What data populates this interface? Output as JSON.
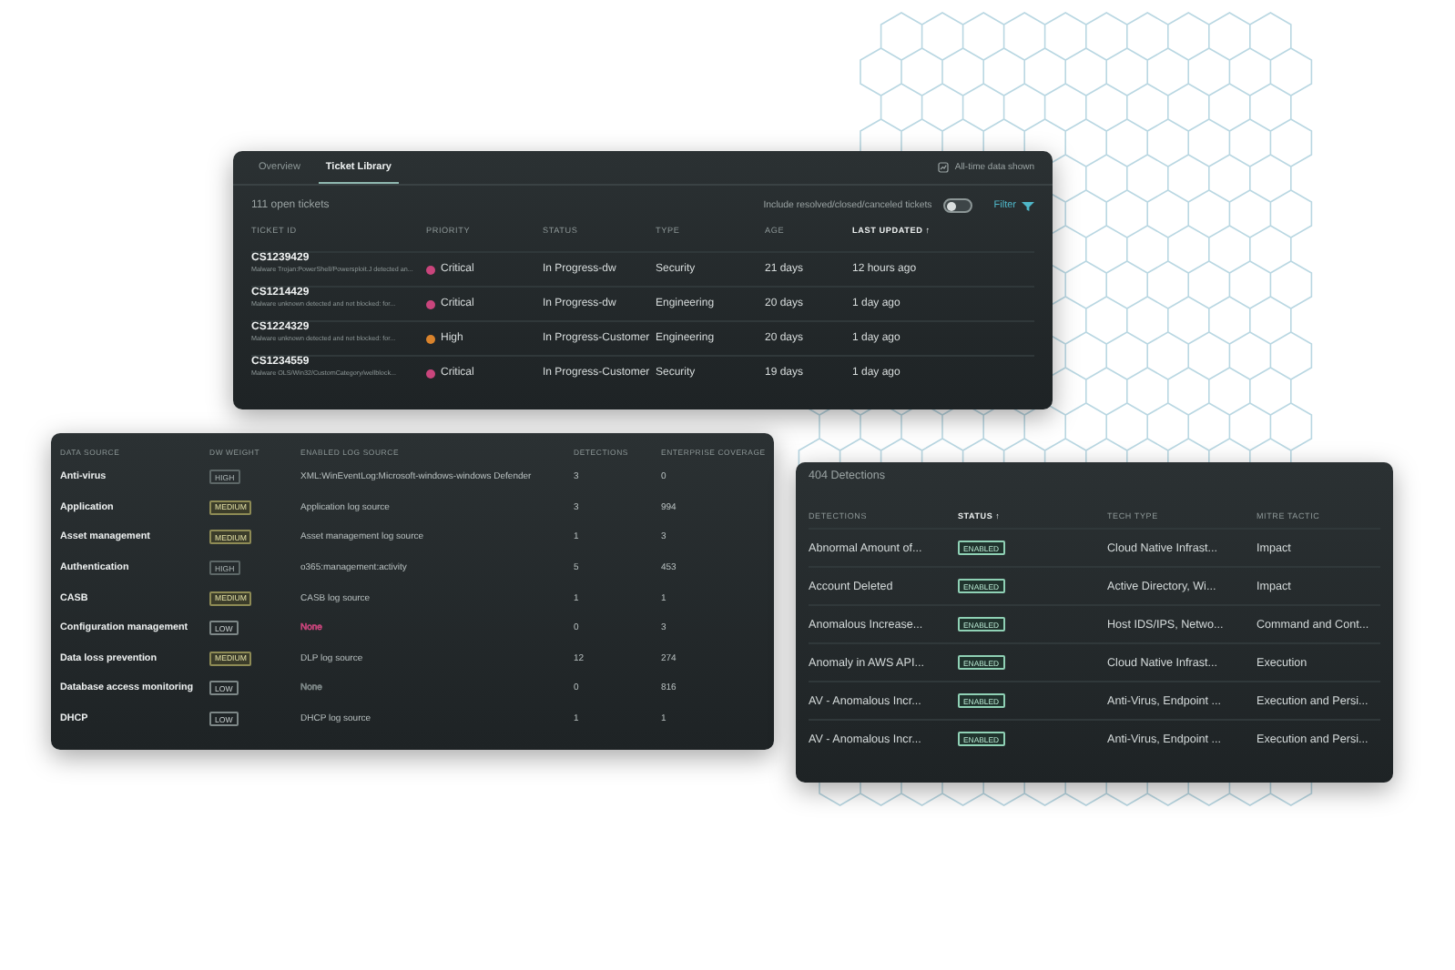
{
  "tickets": {
    "tabs": [
      {
        "label": "Overview",
        "selected": false
      },
      {
        "label": "Ticket Library",
        "selected": true
      }
    ],
    "range_note": "All-time data shown",
    "count": "111 open tickets",
    "include_label": "Include resolved/closed/canceled tickets",
    "include_on": false,
    "filter": "Filter",
    "columns": [
      {
        "label": "TICKET ID",
        "sorted": false
      },
      {
        "label": "PRIORITY",
        "sorted": false
      },
      {
        "label": "STATUS",
        "sorted": false
      },
      {
        "label": "TYPE",
        "sorted": false
      },
      {
        "label": "AGE",
        "sorted": false
      },
      {
        "label": "LAST UPDATED ↑",
        "sorted": true
      }
    ],
    "rows": [
      {
        "id": "CS1239429",
        "summary": "Malware Trojan:PowerShell/Powersploit.J detected an...",
        "priority": "Critical",
        "color": "#c9457c",
        "status": "In Progress-dw",
        "type": "Security",
        "age": "21 days",
        "updated": "12 hours ago"
      },
      {
        "id": "CS1214429",
        "summary": "Malware unknown detected and not blocked: for...",
        "priority": "Critical",
        "color": "#c9457c",
        "status": "In Progress-dw",
        "type": "Engineering",
        "age": "20 days",
        "updated": "1 day ago"
      },
      {
        "id": "CS1224329",
        "summary": "Malware unknown detected and not blocked: for...",
        "priority": "High",
        "color": "#d9832c",
        "status": "In Progress-Customer",
        "type": "Engineering",
        "age": "20 days",
        "updated": "1 day ago"
      },
      {
        "id": "CS1234559",
        "summary": "Malware OLS/Win32/CustomCategory/wellblock...",
        "priority": "Critical",
        "color": "#c9457c",
        "status": "In Progress-Customer",
        "type": "Security",
        "age": "19 days",
        "updated": "1 day ago"
      }
    ]
  },
  "sources": {
    "columns": [
      "DATA SOURCE",
      "DW WEIGHT",
      "ENABLED LOG SOURCE",
      "DETECTIONS",
      "ENTERPRISE COVERAGE"
    ],
    "rows": [
      {
        "name": "Anti-virus",
        "weight": "HIGH",
        "kind": "high",
        "log": "XML:WinEventLog:Microsoft-windows-windows Defender",
        "detections": "3",
        "coverage": "0"
      },
      {
        "name": "Application",
        "weight": "MEDIUM",
        "kind": "medium",
        "log": "Application log source",
        "detections": "3",
        "coverage": "994"
      },
      {
        "name": "Asset management",
        "weight": "MEDIUM",
        "kind": "medium",
        "log": "Asset management log source",
        "detections": "1",
        "coverage": "3"
      },
      {
        "name": "Authentication",
        "weight": "HIGH",
        "kind": "high",
        "log": "o365:management:activity",
        "detections": "5",
        "coverage": "453"
      },
      {
        "name": "CASB",
        "weight": "MEDIUM",
        "kind": "medium",
        "log": "CASB log source",
        "detections": "1",
        "coverage": "1"
      },
      {
        "name": "Configuration management",
        "weight": "LOW",
        "kind": "low",
        "log": "None",
        "color": "#c9457c",
        "detections": "0",
        "coverage": "3"
      },
      {
        "name": "Data loss prevention",
        "weight": "MEDIUM",
        "kind": "medium",
        "log": "DLP log source",
        "detections": "12",
        "coverage": "274"
      },
      {
        "name": "Database access monitoring",
        "weight": "LOW",
        "kind": "low",
        "log": "None",
        "color": "#7d8787",
        "detections": "0",
        "coverage": "816"
      },
      {
        "name": "DHCP",
        "weight": "LOW",
        "kind": "low",
        "log": "DHCP log source",
        "detections": "1",
        "coverage": "1"
      }
    ]
  },
  "detections": {
    "title": "404 Detections",
    "columns": [
      {
        "label": "DETECTIONS",
        "sorted": false
      },
      {
        "label": "STATUS ↑",
        "sorted": true
      },
      {
        "label": "TECH TYPE",
        "sorted": false
      },
      {
        "label": "MITRE TACTIC",
        "sorted": false
      }
    ],
    "rows": [
      {
        "name": "Abnormal Amount of...",
        "status": "ENABLED",
        "tech": "Cloud Native Infrast...",
        "tactic": "Impact"
      },
      {
        "name": "Account Deleted",
        "status": "ENABLED",
        "tech": "Active Directory, Wi...",
        "tactic": "Impact"
      },
      {
        "name": "Anomalous Increase...",
        "status": "ENABLED",
        "tech": "Host IDS/IPS, Netwo...",
        "tactic": "Command and Cont..."
      },
      {
        "name": "Anomaly in AWS API...",
        "status": "ENABLED",
        "tech": "Cloud Native Infrast...",
        "tactic": "Execution"
      },
      {
        "name": "AV - Anomalous Incr...",
        "status": "ENABLED",
        "tech": "Anti-Virus, Endpoint ...",
        "tactic": "Execution and Persi..."
      },
      {
        "name": "AV - Anomalous Incr...",
        "status": "ENABLED",
        "tech": "Anti-Virus, Endpoint ...",
        "tactic": "Execution and Persi..."
      }
    ]
  }
}
